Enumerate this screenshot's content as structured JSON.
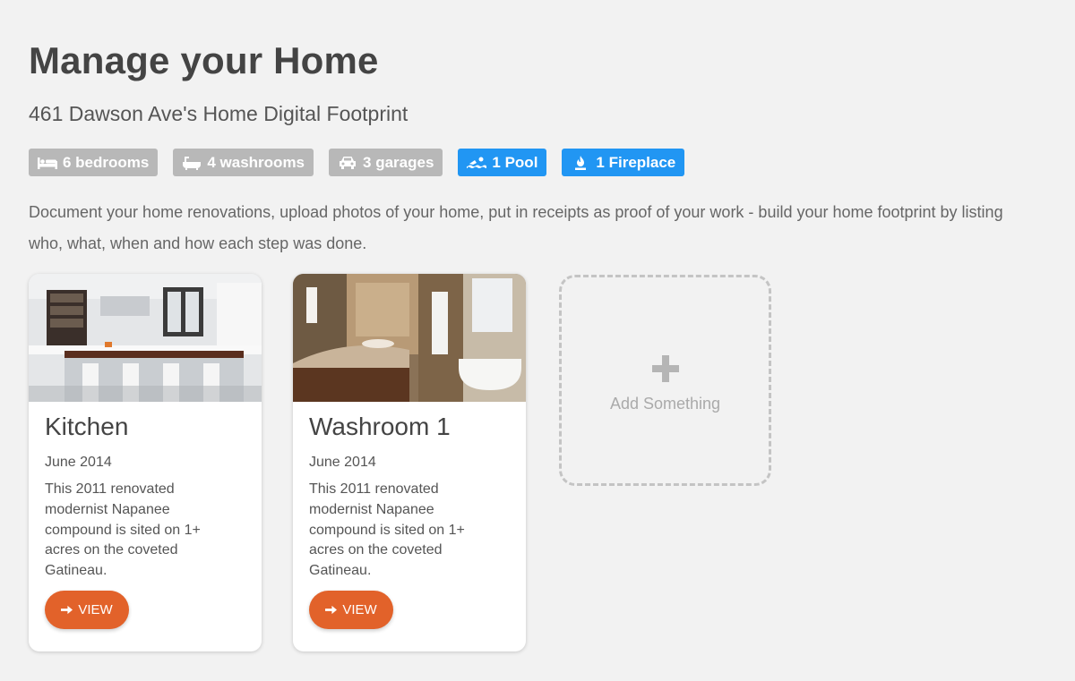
{
  "page": {
    "title": "Manage your Home",
    "subtitle": "461 Dawson Ave's Home Digital Footprint",
    "description": "Document your home renovations, upload photos of your home, put in receipts as proof of your work - build your home footprint by listing who, what, when and how each step was done."
  },
  "badges": [
    {
      "label": "6 bedrooms",
      "icon": "bed-icon",
      "color": "#b8b8b8"
    },
    {
      "label": "4 washrooms",
      "icon": "bathtub-icon",
      "color": "#b8b8b8"
    },
    {
      "label": "3 garages",
      "icon": "car-icon",
      "color": "#b8b8b8"
    },
    {
      "label": "1 Pool",
      "icon": "swimmer-icon",
      "color": "#2196f3"
    },
    {
      "label": "1 Fireplace",
      "icon": "fire-icon",
      "color": "#2196f3"
    }
  ],
  "cards": [
    {
      "title": "Kitchen",
      "date": "June 2014",
      "text": "This 2011 renovated modernist Napanee compound is sited on 1+ acres on the coveted Gatineau.",
      "button": "VIEW"
    },
    {
      "title": "Washroom 1",
      "date": "June 2014",
      "text": "This 2011 renovated modernist Napanee compound is sited on 1+ acres on the coveted Gatineau.",
      "button": "VIEW"
    }
  ],
  "add_tile": {
    "label": "Add Something"
  },
  "colors": {
    "accent": "#e2622a",
    "badge_blue": "#2196f3",
    "badge_gray": "#b8b8b8"
  }
}
